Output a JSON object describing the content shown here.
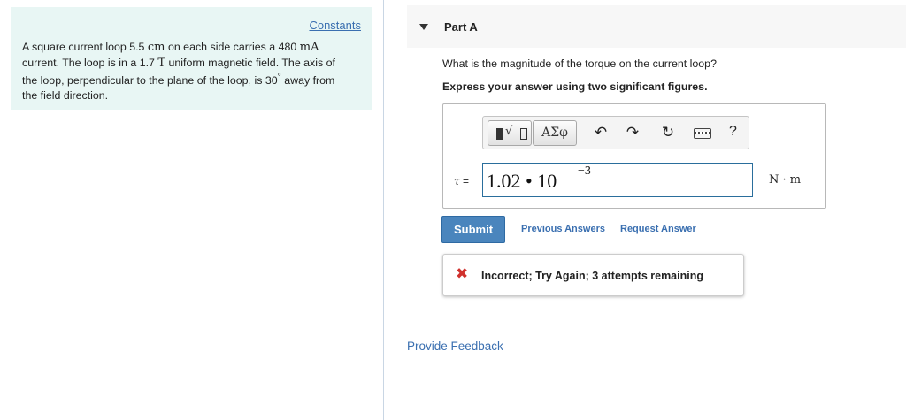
{
  "left": {
    "constants_label": "Constants",
    "problem": {
      "line1_a": "A square current loop 5.5 ",
      "line1_unit1": "cm",
      "line1_b": " on each side carries a 480 ",
      "line1_unit2": "mA",
      "line2_a": "current. The loop is in a 1.7 ",
      "line2_unit": "T",
      "line2_b": " uniform magnetic field. The axis of",
      "line3_a": "the loop, perpendicular to the plane of the loop, is 30",
      "line3_deg": "°",
      "line3_b": " away from",
      "line4": "the field direction."
    }
  },
  "part": {
    "title": "Part A",
    "question": "What is the magnitude of the torque on the current loop?",
    "instruction": "Express your answer using two significant figures."
  },
  "toolbar": {
    "templates_root": "√",
    "symbols_label": "ΑΣφ",
    "undo_glyph": "↶",
    "redo_glyph": "↷",
    "reset_glyph": "↻",
    "help_label": "?",
    "icons": [
      "templates-icon",
      "symbols-icon",
      "undo-icon",
      "redo-icon",
      "reset-icon",
      "keyboard-icon",
      "help-icon"
    ]
  },
  "answer": {
    "variable": "τ",
    "equals": " =",
    "value": "1.02 • 10",
    "exponent": "−3",
    "unit": "N · m"
  },
  "actions": {
    "submit_label": "Submit",
    "previous_answers": "Previous Answers",
    "request_answer": "Request Answer"
  },
  "feedback": {
    "icon_glyph": "✖",
    "message": "Incorrect; Try Again; 3 attempts remaining",
    "status_color": "#d0312d"
  },
  "footer": {
    "provide_feedback": "Provide Feedback"
  },
  "colors": {
    "link": "#3a6fb0",
    "submit_bg": "#4a85bd",
    "problem_bg": "#e8f6f4"
  }
}
